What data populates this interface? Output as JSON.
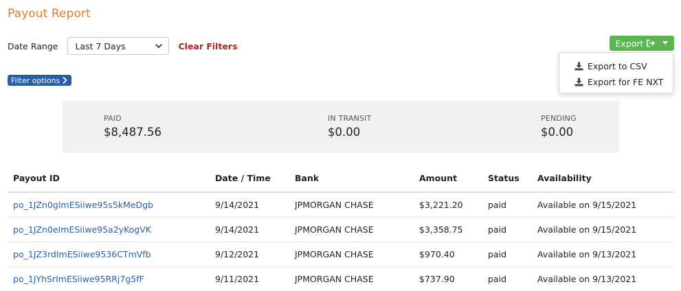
{
  "header": {
    "title": "Payout Report"
  },
  "filters": {
    "date_range_label": "Date Range",
    "date_range_value": "Last 7 Days",
    "clear_label": "Clear Filters",
    "filter_options_label": "Filter options"
  },
  "export": {
    "label": "Export",
    "menu": [
      {
        "label": "Export to CSV",
        "icon": "download-icon"
      },
      {
        "label": "Export for FE NXT",
        "icon": "download-icon"
      }
    ]
  },
  "summary": {
    "paid": {
      "label": "PAID",
      "value": "$8,487.56"
    },
    "in_transit": {
      "label": "IN TRANSIT",
      "value": "$0.00"
    },
    "pending": {
      "label": "PENDING",
      "value": "$0.00"
    }
  },
  "table": {
    "headers": [
      "Payout ID",
      "Date / Time",
      "Bank",
      "Amount",
      "Status",
      "Availability"
    ],
    "rows": [
      [
        "po_1JZn0gImESiiwe95s5kMeDgb",
        "9/14/2021",
        "JPMORGAN CHASE",
        "$3,221.20",
        "paid",
        "Available on 9/15/2021"
      ],
      [
        "po_1JZn0eImESiiwe95a2yKogVK",
        "9/14/2021",
        "JPMORGAN CHASE",
        "$3,358.75",
        "paid",
        "Available on 9/15/2021"
      ],
      [
        "po_1JZ3rdImESiiwe9536CTmVfb",
        "9/12/2021",
        "JPMORGAN CHASE",
        "$970.40",
        "paid",
        "Available on 9/13/2021"
      ],
      [
        "po_1JYhSrImESiiwe95RRj7g5fF",
        "9/11/2021",
        "JPMORGAN CHASE",
        "$737.90",
        "paid",
        "Available on 9/13/2021"
      ]
    ]
  },
  "colors": {
    "title": "#e07a2c",
    "clear": "#b02323",
    "export_bg": "#5ab552",
    "filter_options_bg": "#265ea8",
    "link": "#2b5fa8",
    "summary_bg": "#f1f1f1"
  }
}
